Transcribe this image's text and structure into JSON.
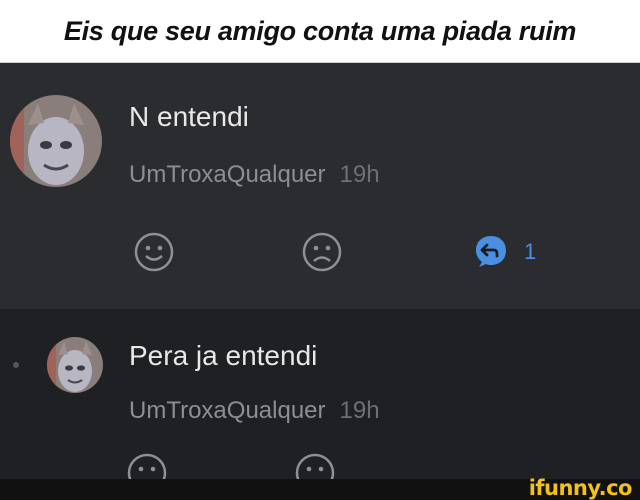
{
  "caption": {
    "text": "Eis que seu amigo conta uma piada ruim"
  },
  "comments": [
    {
      "text": "N entendi",
      "username": "UmTroxaQualquer",
      "time": "19h",
      "reply_count": "1"
    },
    {
      "text": "Pera ja entendi",
      "username": "UmTroxaQualquer",
      "time": "19h"
    }
  ],
  "watermark": {
    "text": "ifunny.co"
  },
  "colors": {
    "accent": "#4a90e2",
    "watermark": "#f2c21a",
    "background": "#2b2c30"
  }
}
